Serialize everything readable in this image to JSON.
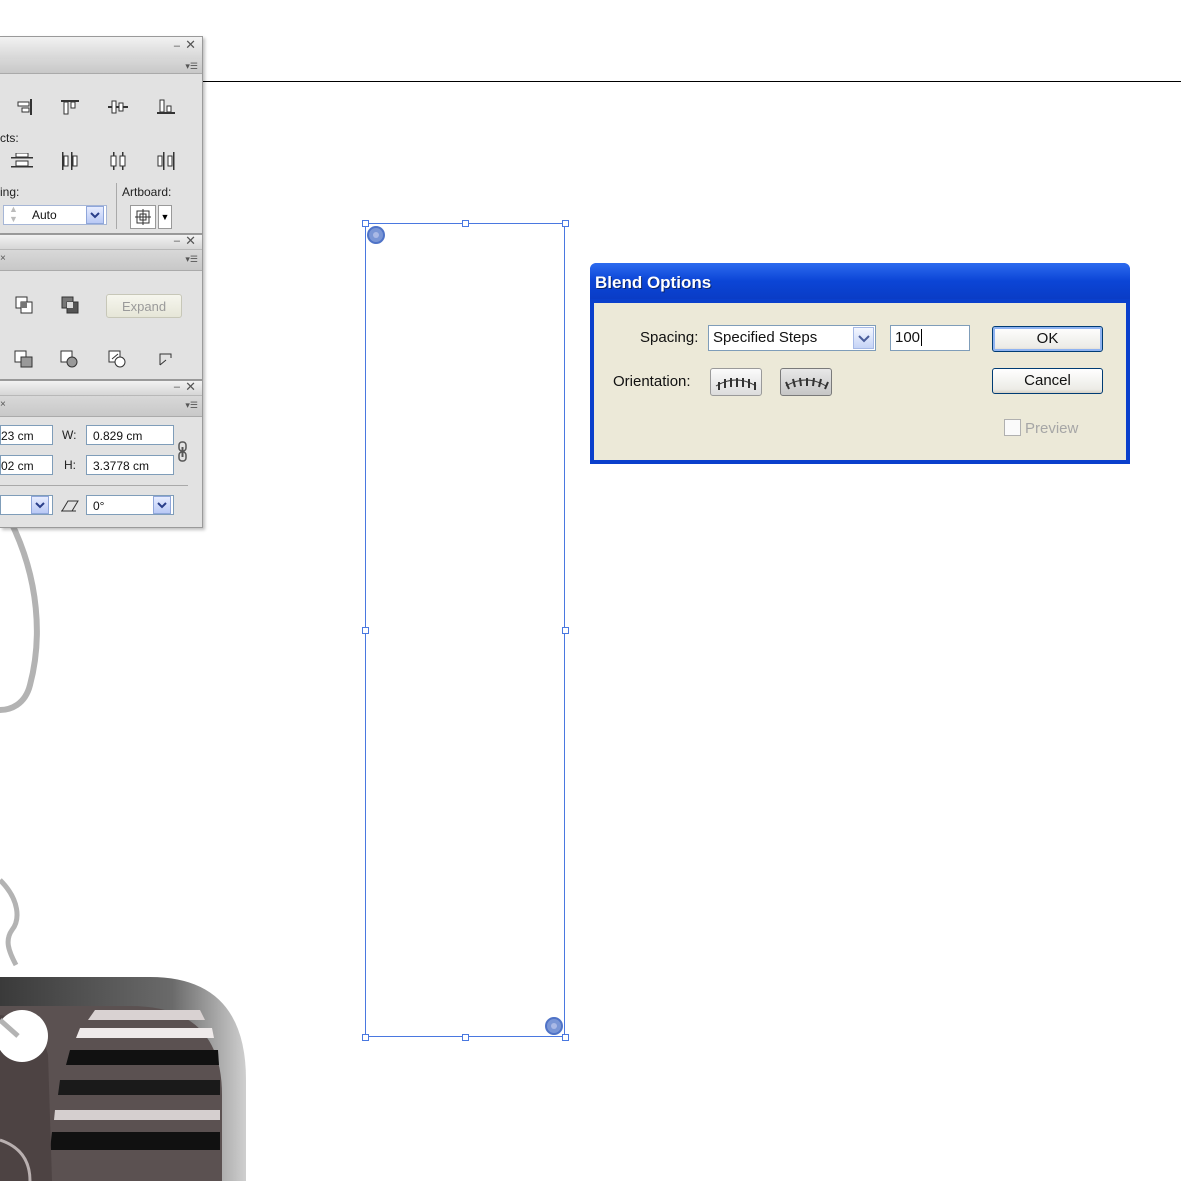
{
  "align_panel": {
    "distribute_objects_label": "cts:",
    "spacing_label": "ing:",
    "spacing_value": "Auto",
    "align_to_label": "Artboard:"
  },
  "pathfinder_panel": {
    "expand_label": "Expand"
  },
  "transform_panel": {
    "x_value": "23 cm",
    "y_value": "02 cm",
    "w_label": "W:",
    "w_value": "0.829 cm",
    "h_label": "H:",
    "h_value": "3.3778 cm",
    "shear_value": "0°"
  },
  "dialog": {
    "title": "Blend Options",
    "spacing_label": "Spacing:",
    "spacing_option": "Specified Steps",
    "steps_value": "100",
    "orientation_label": "Orientation:",
    "ok_label": "OK",
    "cancel_label": "Cancel",
    "preview_label": "Preview",
    "preview_checked": false
  },
  "icons": [
    "align-icon",
    "distribute-icon",
    "pathfinder-icon",
    "link-icon",
    "shear-icon",
    "chevron-down-icon",
    "align-to-page-icon",
    "align-to-path-icon"
  ],
  "colors": {
    "selection": "#4a78e0",
    "dialog_title_bg": "#0a3fcc",
    "dialog_body_bg": "#ece9d8",
    "panel_bg": "#e2e2e2"
  }
}
